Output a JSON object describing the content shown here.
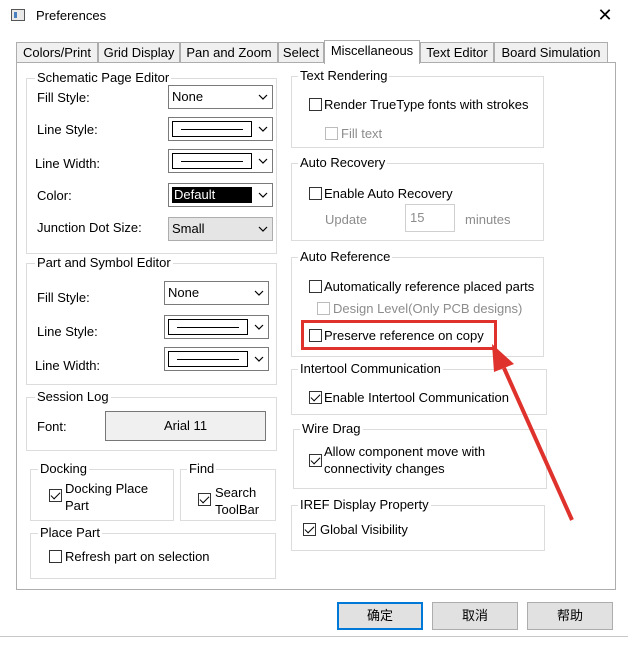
{
  "window": {
    "title": "Preferences",
    "close_glyph": "✕"
  },
  "tabs": [
    {
      "label": "Colors/Print"
    },
    {
      "label": "Grid Display"
    },
    {
      "label": "Pan and Zoom"
    },
    {
      "label": "Select"
    },
    {
      "label": "Miscellaneous",
      "active": true
    },
    {
      "label": "Text Editor"
    },
    {
      "label": "Board Simulation"
    }
  ],
  "schematic": {
    "title": "Schematic Page Editor",
    "fill_style_label": "Fill Style:",
    "fill_style_value": "None",
    "line_style_label": "Line Style:",
    "line_width_label": "Line Width:",
    "color_label": "Color:",
    "color_value": "Default",
    "junction_label": "Junction Dot Size:",
    "junction_value": "Small"
  },
  "part_symbol": {
    "title": "Part and Symbol Editor",
    "fill_style_label": "Fill Style:",
    "fill_style_value": "None",
    "line_style_label": "Line Style:",
    "line_width_label": "Line Width:"
  },
  "session_log": {
    "title": "Session Log",
    "font_label": "Font:",
    "font_value": "Arial 11"
  },
  "docking": {
    "title": "Docking",
    "option_line1": "Docking Place",
    "option_line2": "Part",
    "checked": true
  },
  "find": {
    "title": "Find",
    "option_line1": "Search",
    "option_line2": "ToolBar",
    "checked": true
  },
  "place_part": {
    "title": "Place Part",
    "option": "Refresh part on selection",
    "checked": false
  },
  "text_rendering": {
    "title": "Text Rendering",
    "option1": "Render TrueType fonts with strokes",
    "option2": "Fill text"
  },
  "auto_recovery": {
    "title": "Auto Recovery",
    "option": "Enable Auto Recovery",
    "update_label": "Update",
    "update_value": "15",
    "minutes_label": "minutes"
  },
  "auto_reference": {
    "title": "Auto Reference",
    "option1": "Automatically reference placed parts",
    "option2": "Design Level(Only PCB designs)",
    "option3": "Preserve reference on copy"
  },
  "intertool": {
    "title": "Intertool Communication",
    "option": "Enable Intertool Communication",
    "checked": true
  },
  "wire_drag": {
    "title": "Wire Drag",
    "option_line1": "Allow component move with",
    "option_line2": "connectivity changes",
    "checked": true
  },
  "iref": {
    "title": "IREF Display Property",
    "option": "Global Visibility",
    "checked": true
  },
  "buttons": {
    "ok": "确定",
    "cancel": "取消",
    "help": "帮助"
  },
  "colors": {
    "highlight": "#e0322c",
    "accent": "#0078d7"
  }
}
